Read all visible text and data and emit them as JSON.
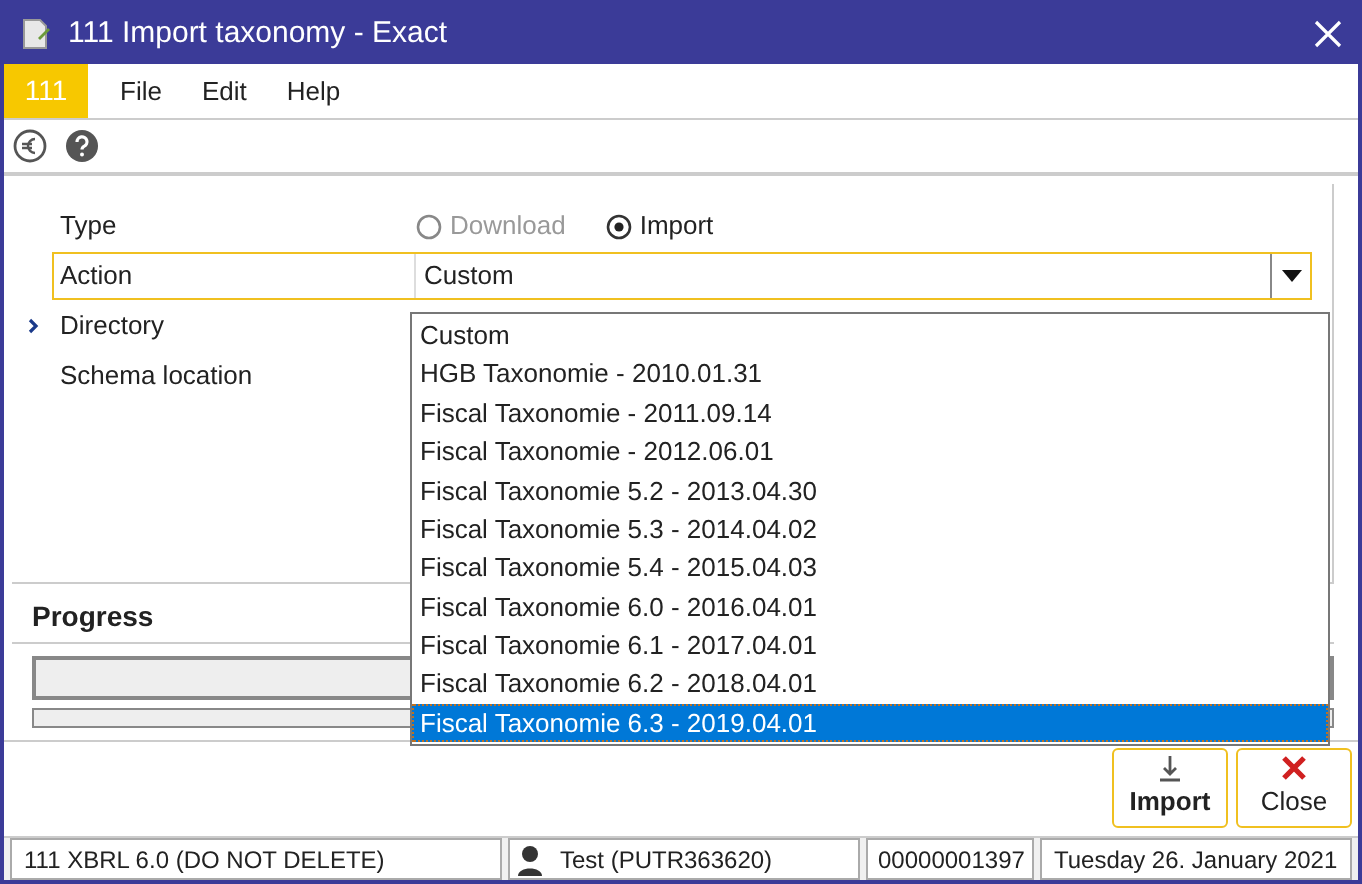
{
  "window": {
    "title": "111 Import taxonomy - Exact"
  },
  "menu": {
    "badge": "111",
    "items": [
      "File",
      "Edit",
      "Help"
    ]
  },
  "form": {
    "type": {
      "label": "Type",
      "options": [
        {
          "label": "Download",
          "selected": false,
          "disabled": true
        },
        {
          "label": "Import",
          "selected": true,
          "disabled": false
        }
      ]
    },
    "action": {
      "label": "Action",
      "value": "Custom",
      "expanded": true
    },
    "fields": [
      {
        "label": "Directory",
        "current": true
      },
      {
        "label": "Schema location",
        "current": false
      }
    ]
  },
  "dropdown": {
    "options": [
      {
        "label": "Custom",
        "selected": false
      },
      {
        "label": "HGB Taxonomie - 2010.01.31",
        "selected": false
      },
      {
        "label": "Fiscal Taxonomie - 2011.09.14",
        "selected": false
      },
      {
        "label": "Fiscal Taxonomie - 2012.06.01",
        "selected": false
      },
      {
        "label": "Fiscal Taxonomie 5.2 - 2013.04.30",
        "selected": false
      },
      {
        "label": "Fiscal Taxonomie 5.3 - 2014.04.02",
        "selected": false
      },
      {
        "label": "Fiscal Taxonomie 5.4 - 2015.04.03",
        "selected": false
      },
      {
        "label": "Fiscal Taxonomie 6.0 - 2016.04.01",
        "selected": false
      },
      {
        "label": "Fiscal Taxonomie 6.1 - 2017.04.01",
        "selected": false
      },
      {
        "label": "Fiscal Taxonomie 6.2 - 2018.04.01",
        "selected": false
      },
      {
        "label": "Fiscal Taxonomie 6.3 - 2019.04.01",
        "selected": true
      }
    ]
  },
  "progress": {
    "title": "Progress",
    "bars": [
      {
        "level": 0
      },
      {
        "level": 0
      }
    ]
  },
  "buttons": [
    {
      "kind": "import",
      "label": "Import"
    },
    {
      "kind": "close",
      "label": "Close"
    }
  ],
  "status_bar": {
    "company": "111 XBRL 6.0 (DO NOT DELETE)",
    "user": "Test (PUTR363620)",
    "number": "00000001397",
    "date": "Tuesday 26. January 2021"
  }
}
